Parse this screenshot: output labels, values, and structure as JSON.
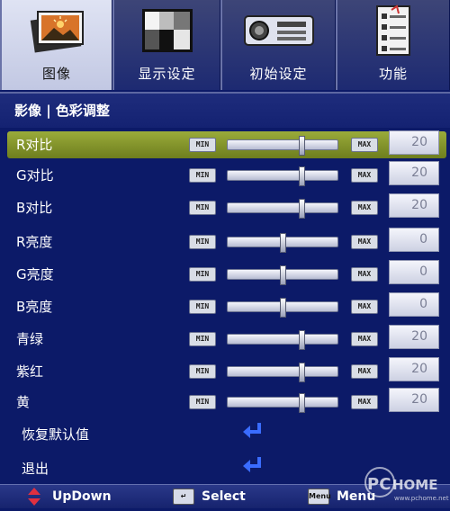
{
  "tabs": [
    {
      "label": "图像",
      "icon": "picture-icon",
      "active": true
    },
    {
      "label": "显示设定",
      "icon": "display-pattern-icon",
      "active": false
    },
    {
      "label": "初始设定",
      "icon": "projector-icon",
      "active": false
    },
    {
      "label": "功能",
      "icon": "checklist-icon",
      "active": false
    }
  ],
  "section_title": "影像 | 色彩调整",
  "slider_min_label": "MIN",
  "slider_max_label": "MAX",
  "rows": [
    {
      "label": "R对比",
      "value": "20",
      "level": 0.68,
      "selected": true
    },
    {
      "label": "G对比",
      "value": "20",
      "level": 0.68,
      "selected": false
    },
    {
      "label": "B对比",
      "value": "20",
      "level": 0.68,
      "selected": false
    },
    {
      "label": "R亮度",
      "value": "0",
      "level": 0.5,
      "selected": false
    },
    {
      "label": "G亮度",
      "value": "0",
      "level": 0.5,
      "selected": false
    },
    {
      "label": "B亮度",
      "value": "0",
      "level": 0.5,
      "selected": false
    },
    {
      "label": "青绿",
      "value": "20",
      "level": 0.68,
      "selected": false
    },
    {
      "label": "紫红",
      "value": "20",
      "level": 0.68,
      "selected": false
    },
    {
      "label": "黄",
      "value": "20",
      "level": 0.68,
      "selected": false
    }
  ],
  "actions": [
    {
      "label": "恢复默认值",
      "icon": "enter-arrow-icon"
    },
    {
      "label": "退出",
      "icon": "enter-arrow-icon"
    }
  ],
  "footer": {
    "updown_label": "UpDown",
    "select_label": "Select",
    "menu_key": "Menu",
    "menu_label": "Menu"
  },
  "watermark": {
    "brand": "PCHOME",
    "url": "www.pchome.net"
  },
  "colors": {
    "background": "#0c1a68",
    "highlight": "#8c9c2e",
    "enter_arrow": "#3a6cff"
  }
}
